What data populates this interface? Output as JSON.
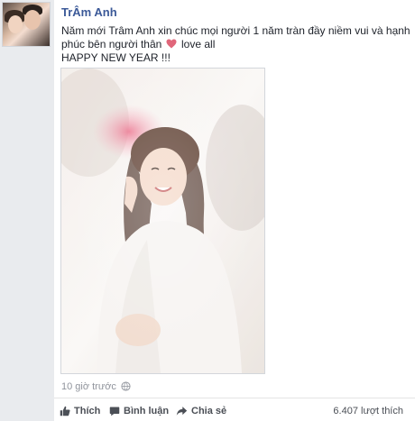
{
  "post": {
    "author": "TrÂm Anh",
    "message_line1": "Năm mới Trâm Anh xin chúc mọi người 1 năm tràn đầy niềm vui và hạnh",
    "message_line2_before": "phúc bên người thân",
    "message_line2_after": "love all",
    "message_line3": "HAPPY NEW YEAR !!!",
    "timestamp": "10 giờ trước",
    "likes_count": "6.407 lượt thích"
  },
  "actions": {
    "like_label": "Thích",
    "comment_label": "Bình luận",
    "share_label": "Chia sẻ"
  },
  "colors": {
    "author_link": "#3b5998",
    "heart": "#e0667a",
    "meta_text": "#90949c",
    "action_text": "#4b4f56"
  },
  "icons": {
    "like": "thumbs-up-icon",
    "comment": "comment-bubble-icon",
    "share": "share-arrow-icon",
    "heart": "heart-emoji-icon",
    "globe": "globe-icon"
  }
}
